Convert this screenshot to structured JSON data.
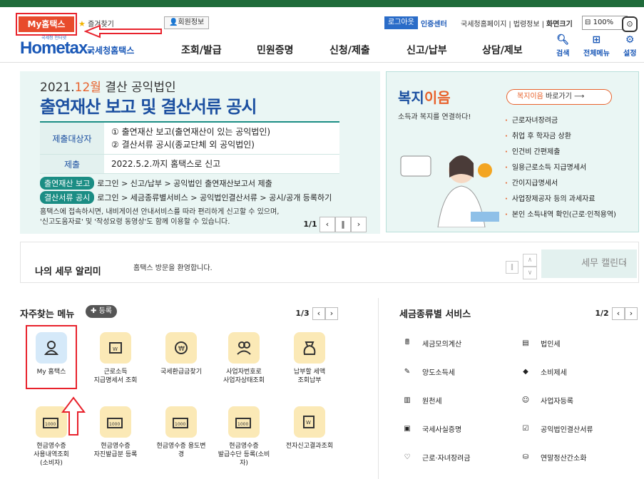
{
  "top": {
    "my_tab": "My홈택스",
    "favorites": "즐겨찾기",
    "member_info": "회원정보",
    "login": "로그아웃",
    "cert_center": "인증센터",
    "links": [
      "국세청홈페이지",
      "법령정보"
    ],
    "screen_size": "화면크기",
    "zoom": "100%"
  },
  "nav": {
    "logo_small": "국세청 인터넷",
    "logo_main": "Hometax.",
    "logo_kr": "국세청홈택스",
    "items": [
      "조회/발급",
      "민원증명",
      "신청/제출",
      "신고/납부",
      "상담/제보"
    ],
    "search": "검색",
    "all_menu": "전체메뉴",
    "settings": "설정"
  },
  "banner": {
    "year_prefix": "2021.",
    "year_highlight": "12월",
    "year_suffix": " 결산 공익법인",
    "title": "출연재산 보고 및 결산서류 공시",
    "rows": [
      {
        "head": "제출대상자",
        "lines": [
          "① 출연재산 보고(출연재산이 있는 공익법인)",
          "② 결산서류 공시(종교단체 외 공익법인)"
        ]
      },
      {
        "head": "제출",
        "lines": [
          "2022.5.2.까지 홈택스로 신고"
        ]
      }
    ],
    "tag1_label": "출연재산 보고",
    "tag1_text": "로그인 > 신고/납부 > 공익법인 출연재산보고서 제출",
    "tag2_label": "결산서류 공시",
    "tag2_text": "로그인 > 세금종류별서비스 > 공익법인결산서류 > 공시/공개 등록하기",
    "note1": "홈택스에 접속하시면, 내비게이션 안내서비스를 따라 편리하게 신고할 수 있으며,",
    "note2": "'신고도움자료' 및 '작성요령 동영상'도 함께 이용할 수 있습니다.",
    "pager": "1/1"
  },
  "welfare": {
    "title_a": "복지",
    "title_b": "이음",
    "sub": "소득과 복지를 연결하다!",
    "go_a": "복지이음",
    "go_b": " 바로가기",
    "items": [
      "근로자녀장려금",
      "취업 후 학자금 상환",
      "인건비 간편제출",
      "일용근로소득 지급명세서",
      "간이지급명세서",
      "사업장제공자 등의 과세자료",
      "본인 소득내역 확인(근로·인적용역)"
    ]
  },
  "notice": {
    "title": "나의 세무 알리미",
    "message": "홈택스 방문을 환영합니다.",
    "calendar": "세무 캘린더"
  },
  "freq": {
    "title": "자주찾는 메뉴",
    "add": "등록",
    "pager": "1/3",
    "tiles": [
      [
        "My 홈택스"
      ],
      [
        "근로소득",
        "지급명세서 조회"
      ],
      [
        "국세환급금찾기"
      ],
      [
        "사업자번호로",
        "사업자상태조회"
      ],
      [
        "납부할 세액",
        "조회납부"
      ],
      [
        "현금영수증",
        "사용내역조회",
        "(소비자)"
      ],
      [
        "현금영수증",
        "자진발급분 등록"
      ],
      [
        "현금영수증 용도변",
        "경"
      ],
      [
        "현금영수증",
        "발급수단 등록(소비",
        "자)"
      ],
      [
        "전자신고결과조회"
      ]
    ]
  },
  "tax": {
    "title": "세금종류별 서비스",
    "pager": "1/2",
    "items": [
      "세금모의계산",
      "법인세",
      "양도소득세",
      "소비제세",
      "원천세",
      "사업자등록",
      "국세사실증명",
      "공익법인결산서류",
      "근로·자녀장려금",
      "연말정산간소화"
    ]
  },
  "colors": {
    "accent_red": "#e8222c",
    "brand_blue": "#1a58b7",
    "teal": "#1b8d84",
    "orange": "#e8622c"
  }
}
